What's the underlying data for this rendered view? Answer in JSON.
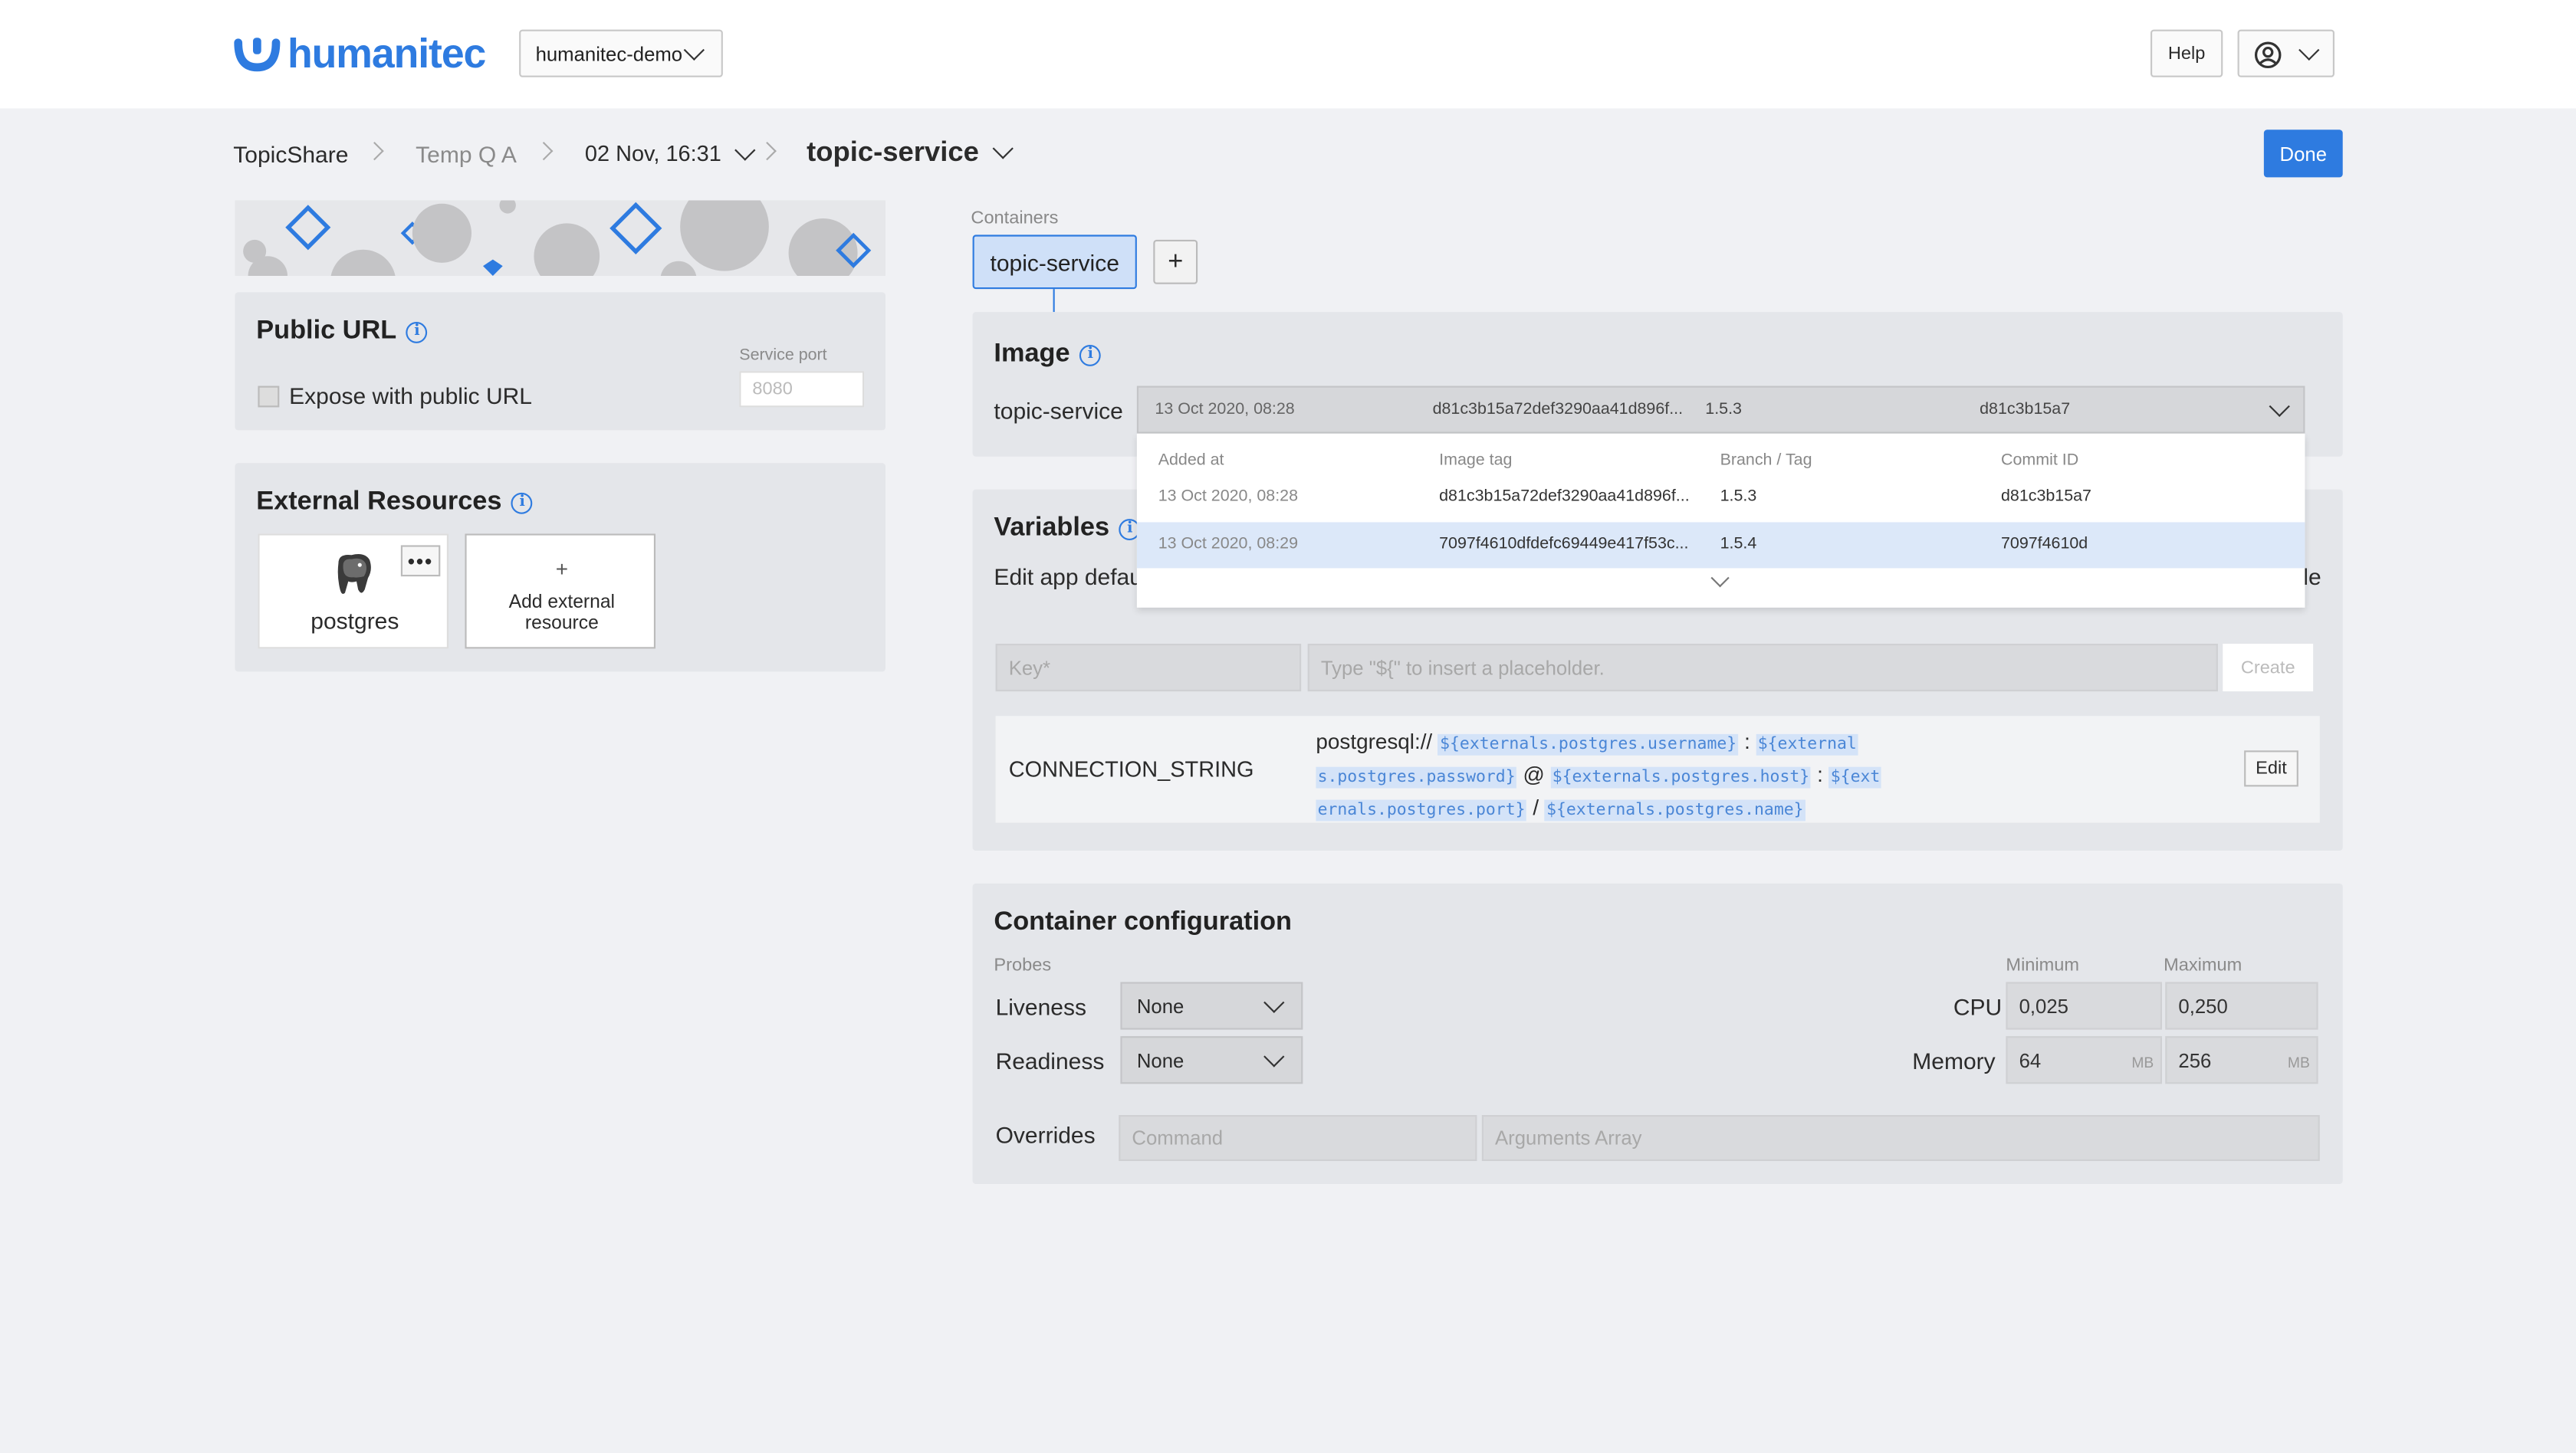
{
  "header": {
    "logo_text": "humanitec",
    "org": "humanitec-demo",
    "help_label": "Help"
  },
  "breadcrumb": {
    "app": "TopicShare",
    "env": "Temp Q A",
    "deploy": "02 Nov, 16:31",
    "module": "topic-service"
  },
  "done_label": "Done",
  "public_url": {
    "title": "Public URL",
    "expose_label": "Expose with public URL",
    "service_port_label": "Service port",
    "service_port_placeholder": "8080"
  },
  "external_resources": {
    "title": "External Resources",
    "resource_name": "postgres",
    "add_label": "Add external resource",
    "add_plus": "+",
    "more": "•••"
  },
  "containers": {
    "label": "Containers",
    "active_tab": "topic-service",
    "add": "+"
  },
  "image": {
    "title": "Image",
    "container_name": "topic-service",
    "selected": {
      "added": "13 Oct 2020, 08:28",
      "tag": "d81c3b15a72def3290aa41d896f...",
      "branch": "1.5.3",
      "commit": "d81c3b15a7"
    },
    "columns": [
      "Added at",
      "Image tag",
      "Branch / Tag",
      "Commit ID"
    ],
    "rows": [
      {
        "added": "13 Oct 2020, 08:28",
        "tag": "d81c3b15a72def3290aa41d896f...",
        "branch": "1.5.3",
        "commit": "d81c3b15a7"
      },
      {
        "added": "13 Oct 2020, 08:29",
        "tag": "7097f4610dfdefc69449e417f53c...",
        "branch": "1.5.4",
        "commit": "7097f4610d"
      }
    ]
  },
  "variables": {
    "title": "Variables",
    "desc_start": "Edit app defau",
    "desc_end": "le",
    "key_placeholder": "Key*",
    "value_placeholder": "Type \"${\" to insert a placeholder.",
    "create_label": "Create",
    "connection": {
      "key": "CONNECTION_STRING",
      "prefix": "postgresql://",
      "t1": "${externals.postgres.username}",
      "sep1": ":",
      "t2a": "${external",
      "t2b": "s.postgres.password}",
      "sep2": "@",
      "t3": "${externals.postgres.host}",
      "sep3": ":",
      "t4a": "${ext",
      "t4b": "ernals.postgres.port}",
      "sep4": "/",
      "t5": "${externals.postgres.name}",
      "edit_label": "Edit"
    }
  },
  "container_config": {
    "title": "Container configuration",
    "probes_label": "Probes",
    "liveness_label": "Liveness",
    "liveness_value": "None",
    "readiness_label": "Readiness",
    "readiness_value": "None",
    "minimum_label": "Minimum",
    "maximum_label": "Maximum",
    "cpu_label": "CPU",
    "cpu_min": "0,025",
    "cpu_max": "0,250",
    "memory_label": "Memory",
    "mem_min": "64",
    "mem_max": "256",
    "mem_unit": "MB",
    "overrides_label": "Overrides",
    "command_placeholder": "Command",
    "args_placeholder": "Arguments Array"
  },
  "colors": {
    "accent": "#2e7be0",
    "panel": "#e4e6ea",
    "selected_row": "#dce8f9"
  }
}
